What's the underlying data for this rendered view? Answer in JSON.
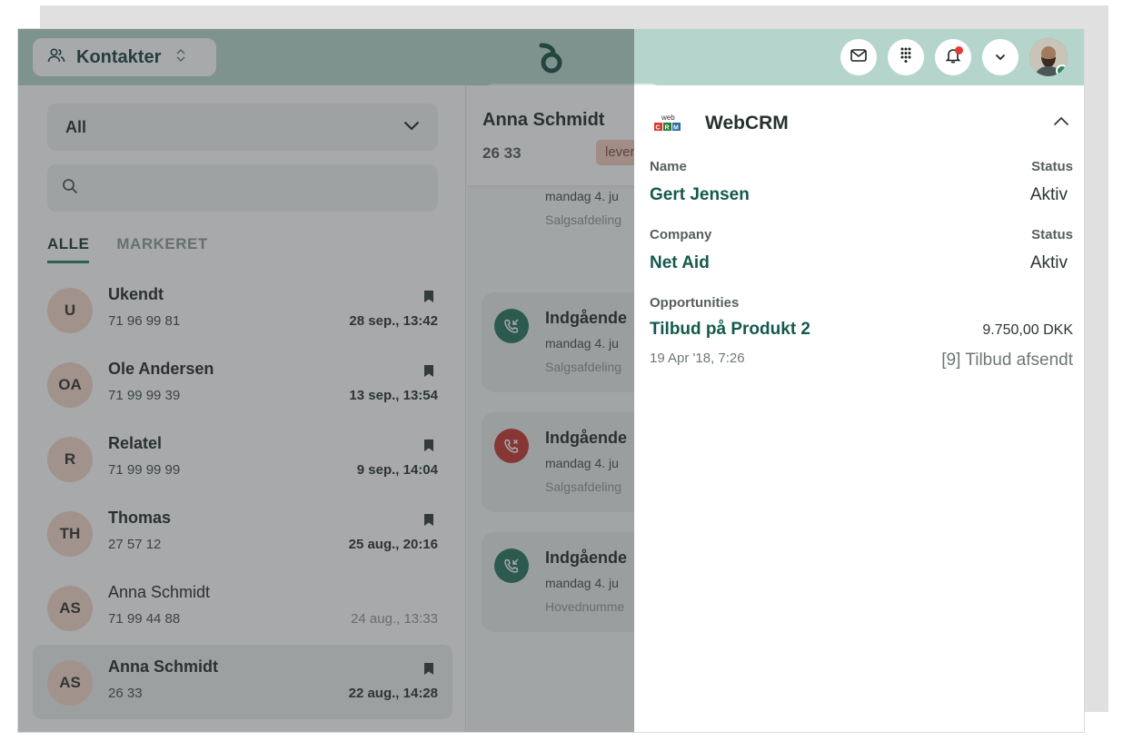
{
  "topbar": {
    "context_label": "Kontakter",
    "icons": [
      "contacts-icon",
      "sort-updown-icon",
      "app-logo",
      "mail-icon",
      "dialpad-icon",
      "bell-icon",
      "chevron-down-icon",
      "user-avatar"
    ]
  },
  "left": {
    "filter_value": "All",
    "search_placeholder": "",
    "tabs": [
      {
        "label": "ALLE",
        "active": true
      },
      {
        "label": "MARKERET",
        "active": false
      }
    ],
    "contacts": [
      {
        "initials": "U",
        "name": "Ukendt",
        "phone": "71 96 99 81",
        "time": "28 sep., 13:42",
        "bookmarked": true
      },
      {
        "initials": "OA",
        "name": "Ole Andersen",
        "phone": "71 99 99 39",
        "time": "13 sep., 13:54",
        "bookmarked": true
      },
      {
        "initials": "R",
        "name": "Relatel",
        "phone": "71 99 99 99",
        "time": "9 sep., 14:04",
        "bookmarked": true
      },
      {
        "initials": "TH",
        "name": "Thomas",
        "phone": "27 57 12",
        "time": "25 aug., 20:16",
        "bookmarked": true
      },
      {
        "initials": "AS",
        "name": "Anna Schmidt",
        "phone": "71 99 44 88",
        "time": "24 aug., 13:33",
        "bookmarked": false
      },
      {
        "initials": "AS",
        "name": "Anna Schmidt",
        "phone": "26 33",
        "time": "22 aug., 14:28",
        "bookmarked": true
      }
    ]
  },
  "middle": {
    "title": "Anna Schmidt",
    "phone": "26 33",
    "tag": "lever",
    "calls": [
      {
        "type": "in",
        "title": "",
        "date": "mandag 4. ju",
        "dept": "Salgsafdeling"
      },
      {
        "type": "in",
        "title": "Indgående",
        "date": "mandag 4. ju",
        "dept": "Salgsafdeling"
      },
      {
        "type": "missed",
        "title": "Indgående",
        "date": "mandag 4. ju",
        "dept": "Salgsafdeling"
      },
      {
        "type": "in",
        "title": "Indgående",
        "date": "mandag 4. ju",
        "dept": "Hovednumme"
      }
    ]
  },
  "crm": {
    "logo_text": "web CRM",
    "title": "WebCRM",
    "name_label": "Name",
    "name_status_label": "Status",
    "name_value": "Gert Jensen",
    "name_status": "Aktiv",
    "company_label": "Company",
    "company_status_label": "Status",
    "company_value": "Net Aid",
    "company_status": "Aktiv",
    "opportunities_label": "Opportunities",
    "opportunity_title": "Tilbud på Produkt 2",
    "opportunity_amount": "9.750,00 DKK",
    "opportunity_date": "19 Apr '18, 7:26",
    "opportunity_status": "[9] Tilbud afsendt"
  },
  "colors": {
    "topbar": "#b5d5cc",
    "accent": "#1f7a67",
    "link": "#135a4d",
    "avatar_bg": "#f6d5c8",
    "missed": "#c4302b"
  }
}
